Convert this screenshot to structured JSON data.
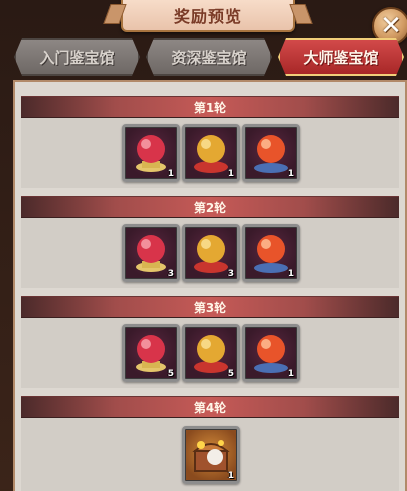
{
  "header": {
    "title": "奖励预览",
    "close_label": "✕"
  },
  "tabs": [
    {
      "label": "入门鉴宝馆",
      "active": false
    },
    {
      "label": "资深鉴宝馆",
      "active": false
    },
    {
      "label": "大师鉴宝馆",
      "active": true
    }
  ],
  "rounds": [
    {
      "label": "第1轮",
      "items": [
        {
          "icon": "red-crystal-ball-icon",
          "qty": "1"
        },
        {
          "icon": "gold-crystal-ball-icon",
          "qty": "1"
        },
        {
          "icon": "orange-crystal-ball-icon",
          "qty": "1"
        }
      ]
    },
    {
      "label": "第2轮",
      "items": [
        {
          "icon": "red-crystal-ball-icon",
          "qty": "3"
        },
        {
          "icon": "gold-crystal-ball-icon",
          "qty": "3"
        },
        {
          "icon": "orange-crystal-ball-icon",
          "qty": "1"
        }
      ]
    },
    {
      "label": "第3轮",
      "items": [
        {
          "icon": "red-crystal-ball-icon",
          "qty": "5"
        },
        {
          "icon": "gold-crystal-ball-icon",
          "qty": "5"
        },
        {
          "icon": "orange-crystal-ball-icon",
          "qty": "1"
        }
      ]
    },
    {
      "label": "第4轮",
      "items": [
        {
          "icon": "treasure-chest-icon",
          "qty": "1"
        }
      ]
    }
  ],
  "colors": {
    "active_tab": "#c43636",
    "round_bar": "#c65a57",
    "panel_bg": "#ddd8d1"
  }
}
